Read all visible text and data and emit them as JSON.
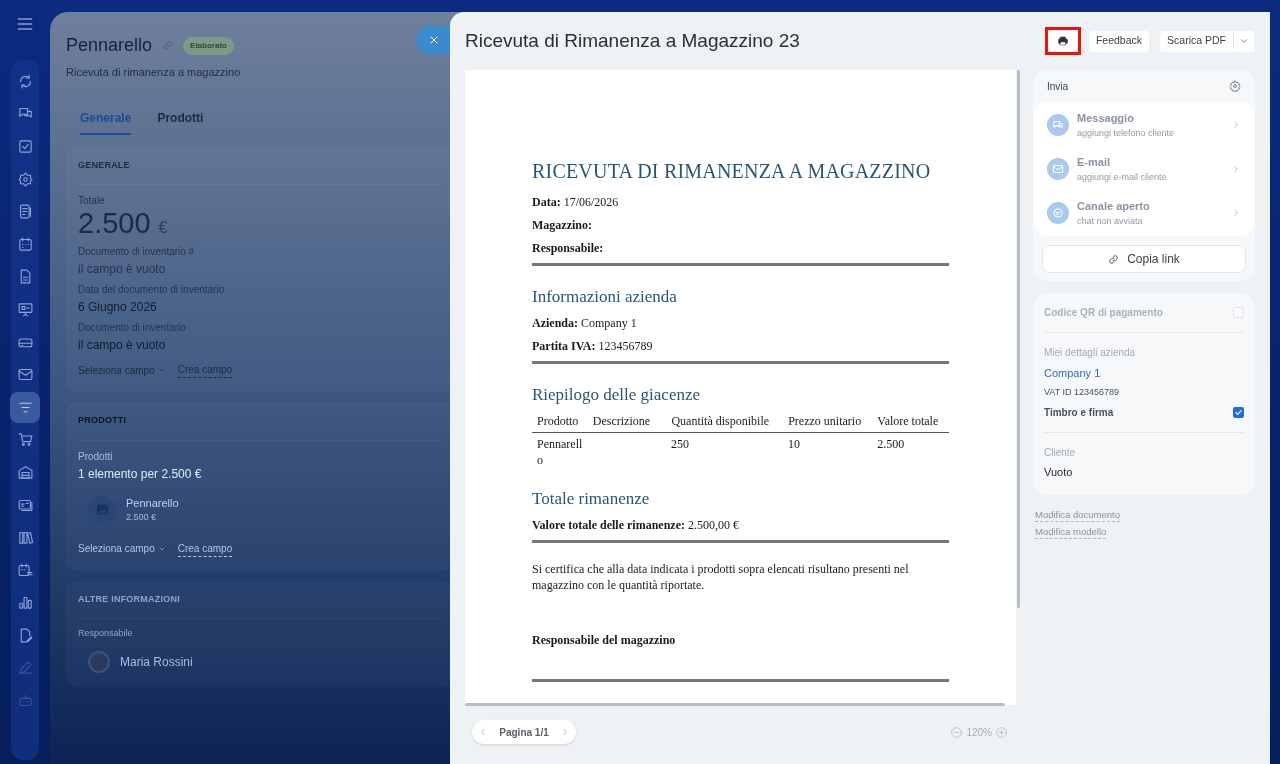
{
  "sidebar": {
    "items": [
      {
        "selected": false
      },
      {
        "selected": false
      },
      {
        "selected": false
      },
      {
        "selected": false
      },
      {
        "selected": false
      },
      {
        "selected": false
      },
      {
        "selected": false
      },
      {
        "selected": false
      },
      {
        "selected": false
      },
      {
        "selected": false
      },
      {
        "selected": true
      },
      {
        "selected": false
      },
      {
        "selected": false
      },
      {
        "selected": false
      },
      {
        "selected": false
      },
      {
        "selected": false
      },
      {
        "selected": false
      },
      {
        "selected": false
      },
      {
        "selected": false
      },
      {
        "selected": false
      }
    ]
  },
  "record": {
    "title": "Pennarello",
    "status": "Elaborato",
    "subtitle": "Ricevuta di rimanenza a magazzino",
    "tabs": [
      {
        "label": "Generale",
        "selected": true
      },
      {
        "label": "Prodotti",
        "selected": false
      }
    ],
    "sections": [
      {
        "heading": "GENERALE",
        "fields": [
          {
            "kind": "amount",
            "label": "Totale",
            "value": "2.500",
            "currency": "€"
          },
          {
            "kind": "empty",
            "label": "Documento di inventario #",
            "value": "il campo è vuoto"
          },
          {
            "kind": "text",
            "label": "Data del documento di inventario",
            "value": "6 Giugno 2026"
          },
          {
            "kind": "text",
            "label": "Documento di inventario",
            "value": "il campo è vuoto"
          }
        ],
        "select_field": "Seleziona campo",
        "create_field": "Crea campo"
      },
      {
        "heading": "PRODOTTI",
        "fields": [
          {
            "kind": "text",
            "label": "Prodotti",
            "value": "1 elemento per 2.500 €"
          },
          {
            "kind": "product",
            "label": "Pennarello",
            "value": "2.500 €"
          }
        ],
        "select_field": "Seleziona campo",
        "create_field": "Crea campo"
      },
      {
        "heading": "ALTRE INFORMAZIONI",
        "fields": [
          {
            "kind": "person",
            "label": "Responsabile",
            "value": "Maria Rossini"
          }
        ]
      }
    ]
  },
  "viewer": {
    "title": "Ricevuta di Rimanenza a Magazzino 23",
    "feedback": "Feedback",
    "download": "Scarica PDF",
    "document": {
      "title": "RICEVUTA DI RIMANENZA A MAGAZZINO",
      "blocks": [
        {
          "kind": "fields",
          "fields": [
            {
              "label": "Data:",
              "value": "17/06/2026"
            },
            {
              "label": "Magazzino:"
            },
            {
              "label": "Responsabile:"
            }
          ]
        },
        {
          "kind": "heading",
          "text": "Informazioni azienda"
        },
        {
          "kind": "fields",
          "fields": [
            {
              "label": "Azienda:",
              "value": "Company 1"
            },
            {
              "label": "Partita IVA:",
              "value": "123456789"
            }
          ]
        },
        {
          "kind": "heading",
          "text": "Riepilogo delle giacenze"
        },
        {
          "kind": "table",
          "columns": [
            "Prodotto",
            "Descrizione",
            "Quantità disponibile",
            "Prezzo unitario",
            "Valore totale"
          ],
          "rows": [
            [
              "Pennarello",
              "",
              "250",
              "10",
              "2.500"
            ]
          ]
        },
        {
          "kind": "heading",
          "text": "Totale rimanenze"
        },
        {
          "kind": "fields",
          "fields": [
            {
              "label": "Valore totale delle rimanenze:",
              "value": "2.500,00 €"
            }
          ]
        },
        {
          "kind": "paragraph",
          "text": "Si certifica che alla data indicata i prodotti sopra elencati risultano presenti nel magazzino con le quantità riportate."
        },
        {
          "kind": "signature",
          "text": "Responsabile del magazzino"
        }
      ]
    },
    "pager": "Pagina 1/1",
    "zoom": "120%",
    "send": {
      "title": "Invia",
      "channels": [
        {
          "name": "Messaggio",
          "hint": "aggiungi telefono cliente",
          "disabled": true
        },
        {
          "name": "E-mail",
          "hint": "aggiungi e-mail cliente",
          "disabled": true
        },
        {
          "name": "Canale aperto",
          "hint": "chat non avviata",
          "disabled": true
        }
      ],
      "copy_link": "Copia link"
    },
    "settings": {
      "qr": {
        "label": "Codice QR di pagamento",
        "checked": false,
        "disabled": true
      },
      "company_label": "Miei dettagli azienda",
      "company": "Company 1",
      "vat": "VAT ID 123456789",
      "stamp": {
        "label": "Timbro e firma",
        "checked": true,
        "disabled": false
      },
      "client_label": "Cliente",
      "client": "Vuoto"
    },
    "links": [
      "Modifica documento",
      "Modifica modello"
    ]
  }
}
